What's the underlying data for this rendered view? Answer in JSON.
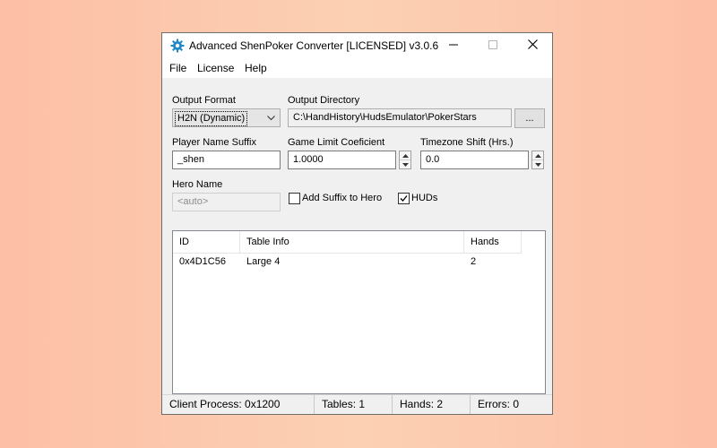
{
  "window": {
    "title": "Advanced ShenPoker Converter [LICENSED] v3.0.6",
    "icon": "gear-icon",
    "accent_color": "#1e88c8"
  },
  "menu": {
    "items": [
      "File",
      "License",
      "Help"
    ]
  },
  "form": {
    "output_format_label": "Output Format",
    "output_format_value": "H2N (Dynamic)",
    "output_directory_label": "Output Directory",
    "output_directory_value": "C:\\HandHistory\\HudsEmulator\\PokerStars",
    "browse_label": "...",
    "player_suffix_label": "Player Name Suffix",
    "player_suffix_value": "_shen",
    "game_limit_label": "Game Limit Coeficient",
    "game_limit_value": "1.0000",
    "timezone_label": "Timezone Shift (Hrs.)",
    "timezone_value": "0.0",
    "hero_name_label": "Hero Name",
    "hero_name_placeholder": "<auto>",
    "add_suffix_label": "Add Suffix to Hero",
    "add_suffix_checked": false,
    "huds_label": "HUDs",
    "huds_checked": true
  },
  "table": {
    "columns": [
      "ID",
      "Table Info",
      "Hands"
    ],
    "rows": [
      [
        "0x4D1C56",
        "Large 4",
        "2"
      ]
    ]
  },
  "status": {
    "client_process": "Client Process:  0x1200",
    "tables": "Tables: 1",
    "hands": "Hands: 2",
    "errors": "Errors: 0"
  }
}
